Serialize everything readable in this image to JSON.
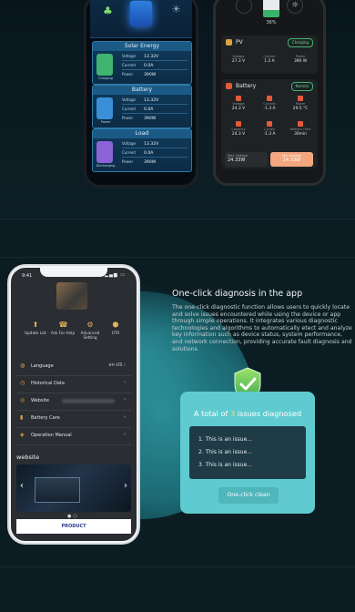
{
  "phone_solar": {
    "panels": [
      {
        "title": "Solar Energy",
        "icon_label": "Charging",
        "icon": "solar-battery-icon",
        "color": "#3fb36f",
        "rows": [
          {
            "key": "Voltage",
            "value": "13.32V"
          },
          {
            "key": "Current",
            "value": "0.0A"
          },
          {
            "key": "Power",
            "value": "390W"
          }
        ]
      },
      {
        "title": "Battery",
        "icon_label": "Power",
        "icon": "battery-icon",
        "color": "#3a8fd8",
        "rows": [
          {
            "key": "Voltage",
            "value": "13.32V"
          },
          {
            "key": "Current",
            "value": "0.0A"
          },
          {
            "key": "Power",
            "value": "390W"
          }
        ]
      },
      {
        "title": "Load",
        "icon_label": "Discharging",
        "icon": "load-battery-icon",
        "color": "#8a63d6",
        "rows": [
          {
            "key": "Voltage",
            "value": "13.32V"
          },
          {
            "key": "Current",
            "value": "0.0A"
          },
          {
            "key": "Power",
            "value": "390W"
          }
        ]
      }
    ]
  },
  "phone_dark": {
    "battery_percent": "36%",
    "battery_level": 0.36,
    "pv": {
      "title": "PV",
      "status": "Charging",
      "cells": [
        {
          "k": "Voltage",
          "v": "27.3 V"
        },
        {
          "k": "Current",
          "v": "1.2 A"
        },
        {
          "k": "Power",
          "v": "390 W"
        }
      ]
    },
    "battery": {
      "title": "Battery",
      "status": "Normal",
      "cells": [
        {
          "k": "Voltage",
          "v": "24.3 V"
        },
        {
          "k": "Current",
          "v": "-1.3 A"
        },
        {
          "k": "Power",
          "v": "29.5 °C"
        },
        {
          "k": "Capacity",
          "v": "24.3 V"
        },
        {
          "k": "Cycles",
          "v": "-1.3 A"
        },
        {
          "k": "Remain Time",
          "v": "30min"
        }
      ]
    },
    "max_voltage": {
      "label": "Max Voltage",
      "value": "24.33W"
    },
    "min_voltage": {
      "label": "Min Voltage",
      "value": "14.33W"
    }
  },
  "phone_app": {
    "time": "9:41",
    "quick_actions": [
      {
        "label": "Update List",
        "icon": "update-icon"
      },
      {
        "label": "Ask For Help",
        "icon": "help-icon"
      },
      {
        "label": "Advanced Setting",
        "icon": "settings-icon"
      },
      {
        "label": "OTA",
        "icon": "ota-icon"
      }
    ],
    "menu": [
      {
        "label": "Language",
        "value": "en-US",
        "icon": "language-icon"
      },
      {
        "label": "Historical Data",
        "value": "",
        "icon": "history-icon"
      },
      {
        "label": "Website",
        "value": "",
        "icon": "website-icon"
      },
      {
        "label": "Battery Care",
        "value": "",
        "icon": "battery-care-icon"
      },
      {
        "label": "Operation Manual",
        "value": "",
        "icon": "manual-icon"
      }
    ],
    "section_title": "website",
    "product_label": "PRODUCT"
  },
  "feature": {
    "title": "One-click diagnosis in the app",
    "description": "The one-click diagnostic function allows users to quickly locate and solve issues encountered while using the device or app through simple operations. It integrates various diagnostic technologies and algorithms to automatically etect and analyze key information such as device status, system performance, and network connection, providing accurate fault diagnosis and solutions."
  },
  "diagnosis": {
    "title_prefix": "A total of",
    "count": "3",
    "title_suffix": "issues diagnosed",
    "issues": [
      "1. This is an issue...",
      "2. This is an issue...",
      "3. This is an issue..."
    ],
    "button_label": "One-click clean"
  },
  "colors": {
    "accent": "#5fcbd0",
    "highlight": "#ffe24a",
    "card_bg": "#1e3b46"
  }
}
